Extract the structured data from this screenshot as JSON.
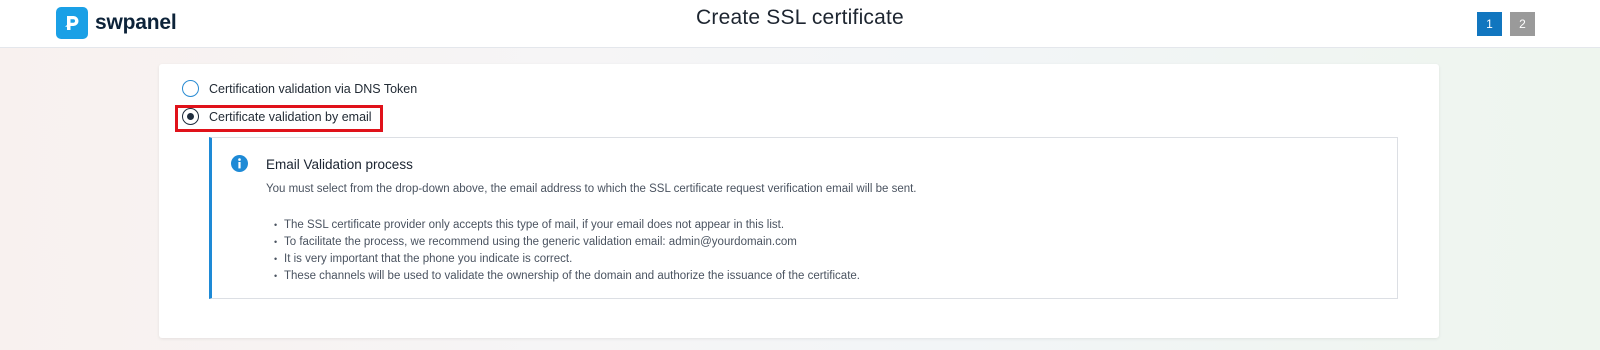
{
  "header": {
    "logo_text": "swpanel",
    "title": "Create SSL certificate",
    "steps": [
      "1",
      "2"
    ],
    "active_step": "1"
  },
  "validation_options": [
    {
      "label": "Certification validation via DNS Token",
      "checked": false
    },
    {
      "label": "Certificate validation by email",
      "checked": true
    }
  ],
  "info": {
    "icon": "info-icon",
    "title": "Email Validation process",
    "description": "You must select from the drop-down above, the email address to which the SSL certificate request verification email will be sent.",
    "bullets": [
      "The SSL certificate provider only accepts this type of mail, if your email does not appear in this list.",
      "To facilitate the process, we recommend using the generic validation email: admin@yourdomain.com",
      "It is very important that the phone you indicate is correct.",
      "These channels will be used to validate the ownership of the domain and authorize the issuance of the certificate."
    ]
  },
  "colors": {
    "brand": "#1aa0e6",
    "active_step": "#1176bf",
    "inactive_step": "#9a9a9a",
    "info_accent": "#1e8ad6",
    "highlight": "#e0121a"
  }
}
